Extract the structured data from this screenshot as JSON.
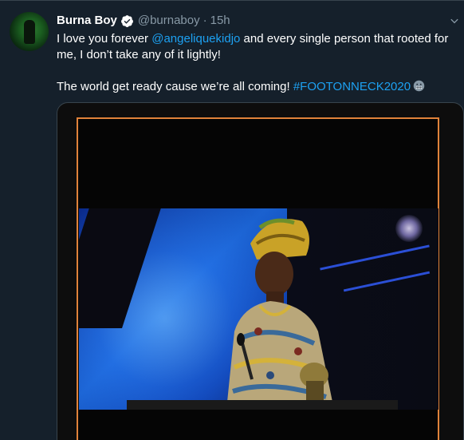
{
  "tweet": {
    "author": {
      "name": "Burna Boy",
      "handle": "@burnaboy",
      "verified": true,
      "avatar_icon": "avatar-image"
    },
    "separator": "·",
    "time": "15h",
    "menu_icon": "chevron-down-icon",
    "text": {
      "line1_pre": "I love you forever ",
      "mention": "@angeliquekidjo",
      "line1_post": " and every single person that rooted for me, I don’t take any of it lightly!",
      "line2_pre": "The world get ready cause we’re all coming! ",
      "hashtag": "#FOOTONNECK2020",
      "emoji_icon": "grimacing-face-emoji"
    },
    "media": {
      "type": "video",
      "description_icon": "video-frame"
    }
  },
  "colors": {
    "background": "#15202b",
    "text": "#ffffff",
    "secondary": "#8899a6",
    "link": "#1da1f2",
    "frame_border": "#e0823a"
  }
}
